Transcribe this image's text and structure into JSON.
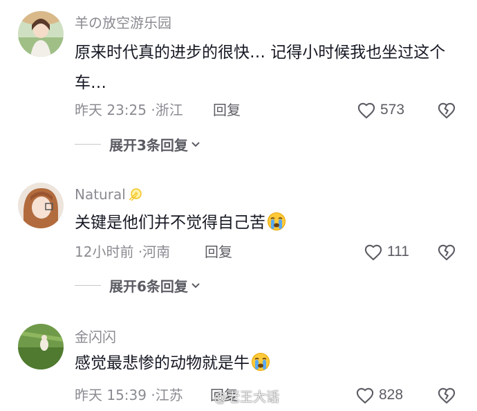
{
  "comments": [
    {
      "username": "羊の放空游乐园",
      "content": "原来时代真的进步的很快… 记得小时候我也坐过这个车…",
      "time": "昨天 23:25",
      "location": "浙江",
      "reply_label": "回复",
      "likes": "573",
      "expand_label": "展开3条回复"
    },
    {
      "username": "Natural",
      "content": "关键是他们并不觉得自己苦",
      "emoji": "crying-face-emoji",
      "time": "12小时前",
      "location": "河南",
      "reply_label": "回复",
      "likes": "111",
      "expand_label": "展开6条回复"
    },
    {
      "username": "金闪闪",
      "content": "感觉最悲惨的动物就是牛",
      "emoji": "crying-face-emoji",
      "time": "昨天 15:39",
      "location": "江苏",
      "reply_label": "回复",
      "likes": "828"
    }
  ],
  "meta_separator": "·",
  "watermark": "@老王大话",
  "colors": {
    "text_primary": "#161823",
    "text_secondary": "#8a8b91",
    "action": "#5b5c63"
  }
}
